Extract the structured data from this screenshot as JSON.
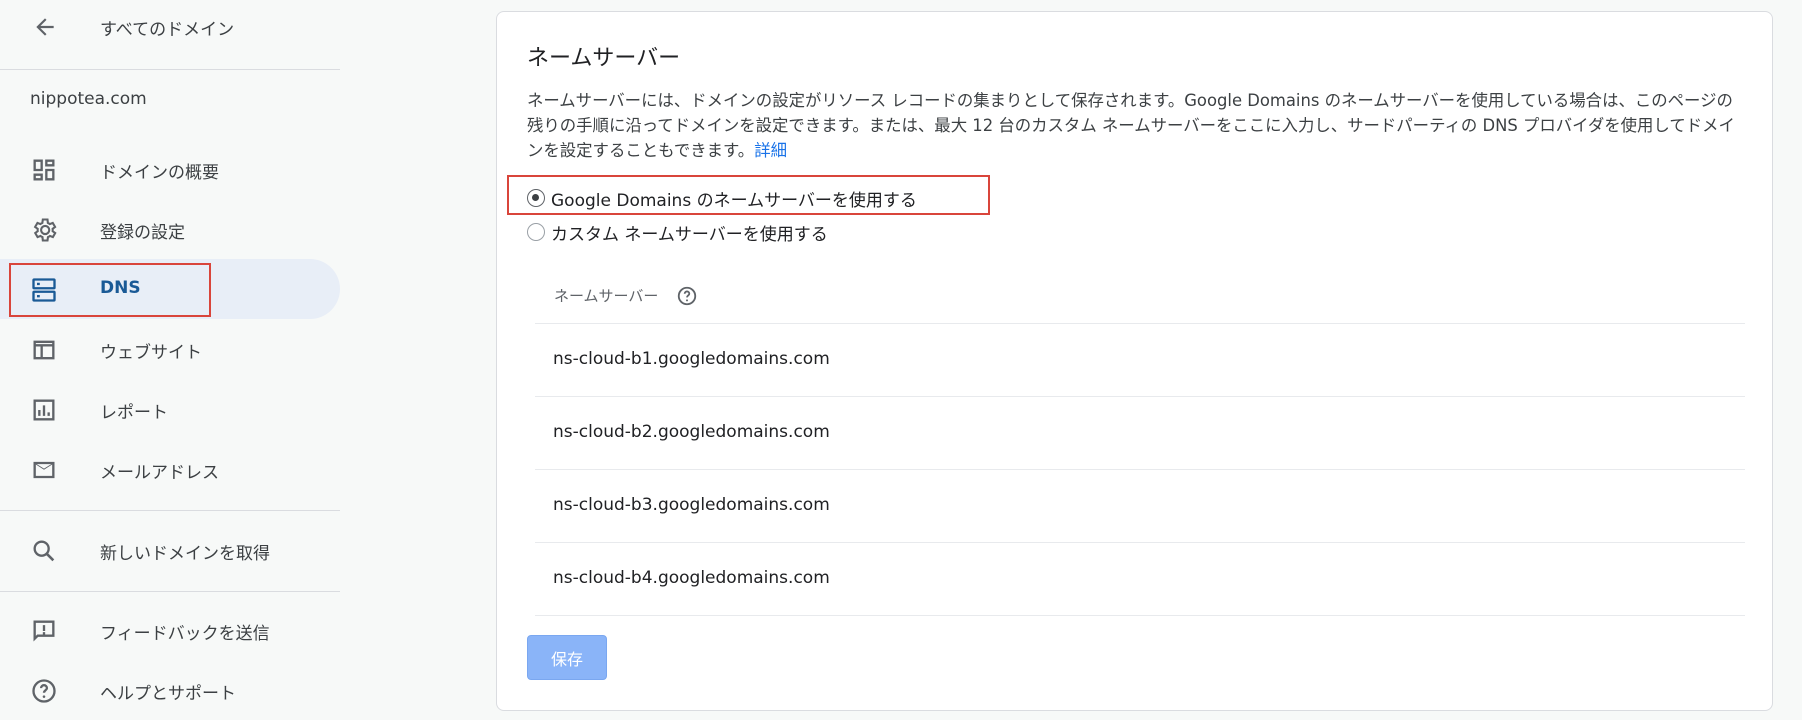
{
  "sidebar": {
    "back_label": "すべてのドメイン",
    "domain": "nippotea.com",
    "items": [
      {
        "label": "ドメインの概要",
        "icon": "dashboard-icon"
      },
      {
        "label": "登録の設定",
        "icon": "gear-icon"
      },
      {
        "label": "DNS",
        "icon": "dns-icon",
        "active": true
      },
      {
        "label": "ウェブサイト",
        "icon": "website-icon"
      },
      {
        "label": "レポート",
        "icon": "report-icon"
      },
      {
        "label": "メールアドレス",
        "icon": "mail-icon"
      }
    ],
    "secondary": [
      {
        "label": "新しいドメインを取得",
        "icon": "search-icon"
      }
    ],
    "footer": [
      {
        "label": "フィードバックを送信",
        "icon": "feedback-icon"
      },
      {
        "label": "ヘルプとサポート",
        "icon": "help-icon"
      }
    ]
  },
  "main": {
    "title": "ネームサーバー",
    "description": "ネームサーバーには、ドメインの設定がリソース レコードの集まりとして保存されます。Google Domains のネームサーバーを使用している場合は、このページの残りの手順に沿ってドメインを設定できます。または、最大 12 台のカスタム ネームサーバーをここに入力し、サードパーティの DNS プロバイダを使用してドメインを設定することもできます。",
    "details_link": "詳細",
    "options": [
      {
        "label": "Google Domains のネームサーバーを使用する",
        "selected": true
      },
      {
        "label": "カスタム ネームサーバーを使用する",
        "selected": false
      }
    ],
    "ns_header": "ネームサーバー",
    "nameservers": [
      "ns-cloud-b1.googledomains.com",
      "ns-cloud-b2.googledomains.com",
      "ns-cloud-b3.googledomains.com",
      "ns-cloud-b4.googledomains.com"
    ],
    "save_label": "保存"
  },
  "colors": {
    "accent": "#1a73e8",
    "active_bg": "#e8eef7",
    "highlight": "#d9453b",
    "save_button": "#8ab4f8"
  }
}
